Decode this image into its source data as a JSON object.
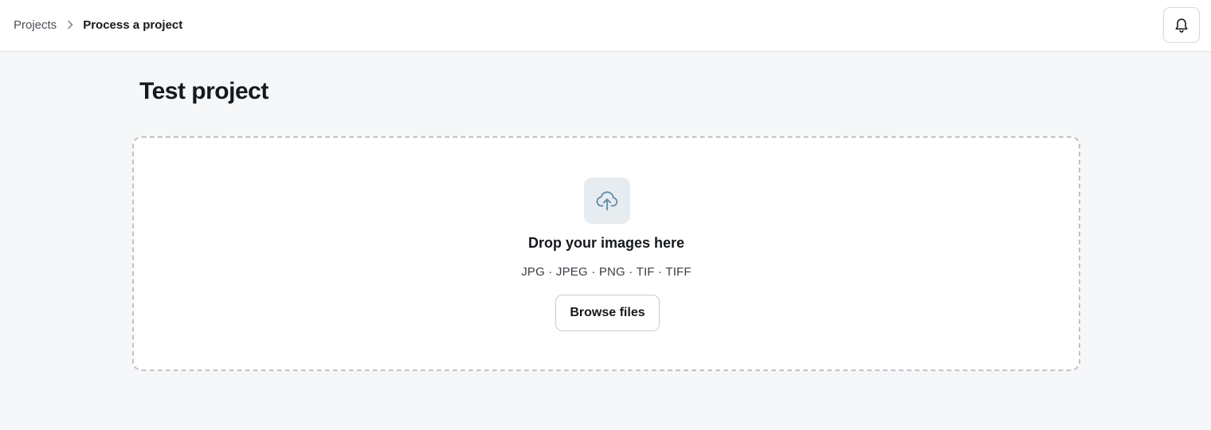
{
  "header": {
    "breadcrumb": {
      "parent": "Projects",
      "current": "Process a project"
    },
    "notifications_icon": "bell-icon"
  },
  "main": {
    "title": "Test project",
    "dropzone": {
      "icon": "cloud-upload-icon",
      "heading": "Drop your images here",
      "formats": "JPG · JPEG · PNG · TIF · TIFF",
      "browse_label": "Browse files"
    }
  },
  "colors": {
    "page_background": "#f5f7f8",
    "icon_tile_background": "#e6ecef",
    "upload_icon": "#5f8ba6",
    "dashed_border": "#bfc3c7"
  }
}
